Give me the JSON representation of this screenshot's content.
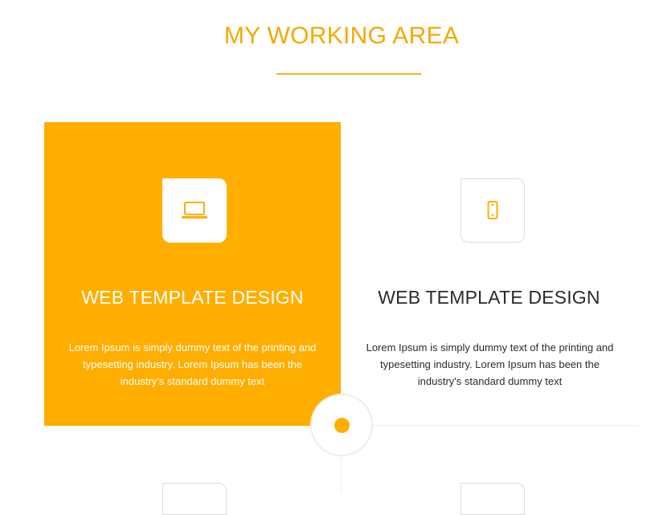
{
  "section": {
    "title": "MY WORKING AREA"
  },
  "cards": [
    {
      "icon": "laptop-icon",
      "title": "WEB TEMPLATE DESIGN",
      "text": "Lorem Ipsum is simply dummy text of the printing and typesetting industry. Lorem Ipsum has been the industry's standard dummy text",
      "state": "active"
    },
    {
      "icon": "mobile-phone-icon",
      "title": "WEB TEMPLATE DESIGN",
      "text": "Lorem Ipsum is simply dummy text of the printing and typesetting industry. Lorem Ipsum has been the industry's standard dummy text",
      "state": "default"
    }
  ],
  "colors": {
    "accent": "#ffae00",
    "title_accent": "#f6a800",
    "heading_dark": "#2b2b2b",
    "border_light": "#dcdcdc",
    "background": "#ffffff"
  }
}
